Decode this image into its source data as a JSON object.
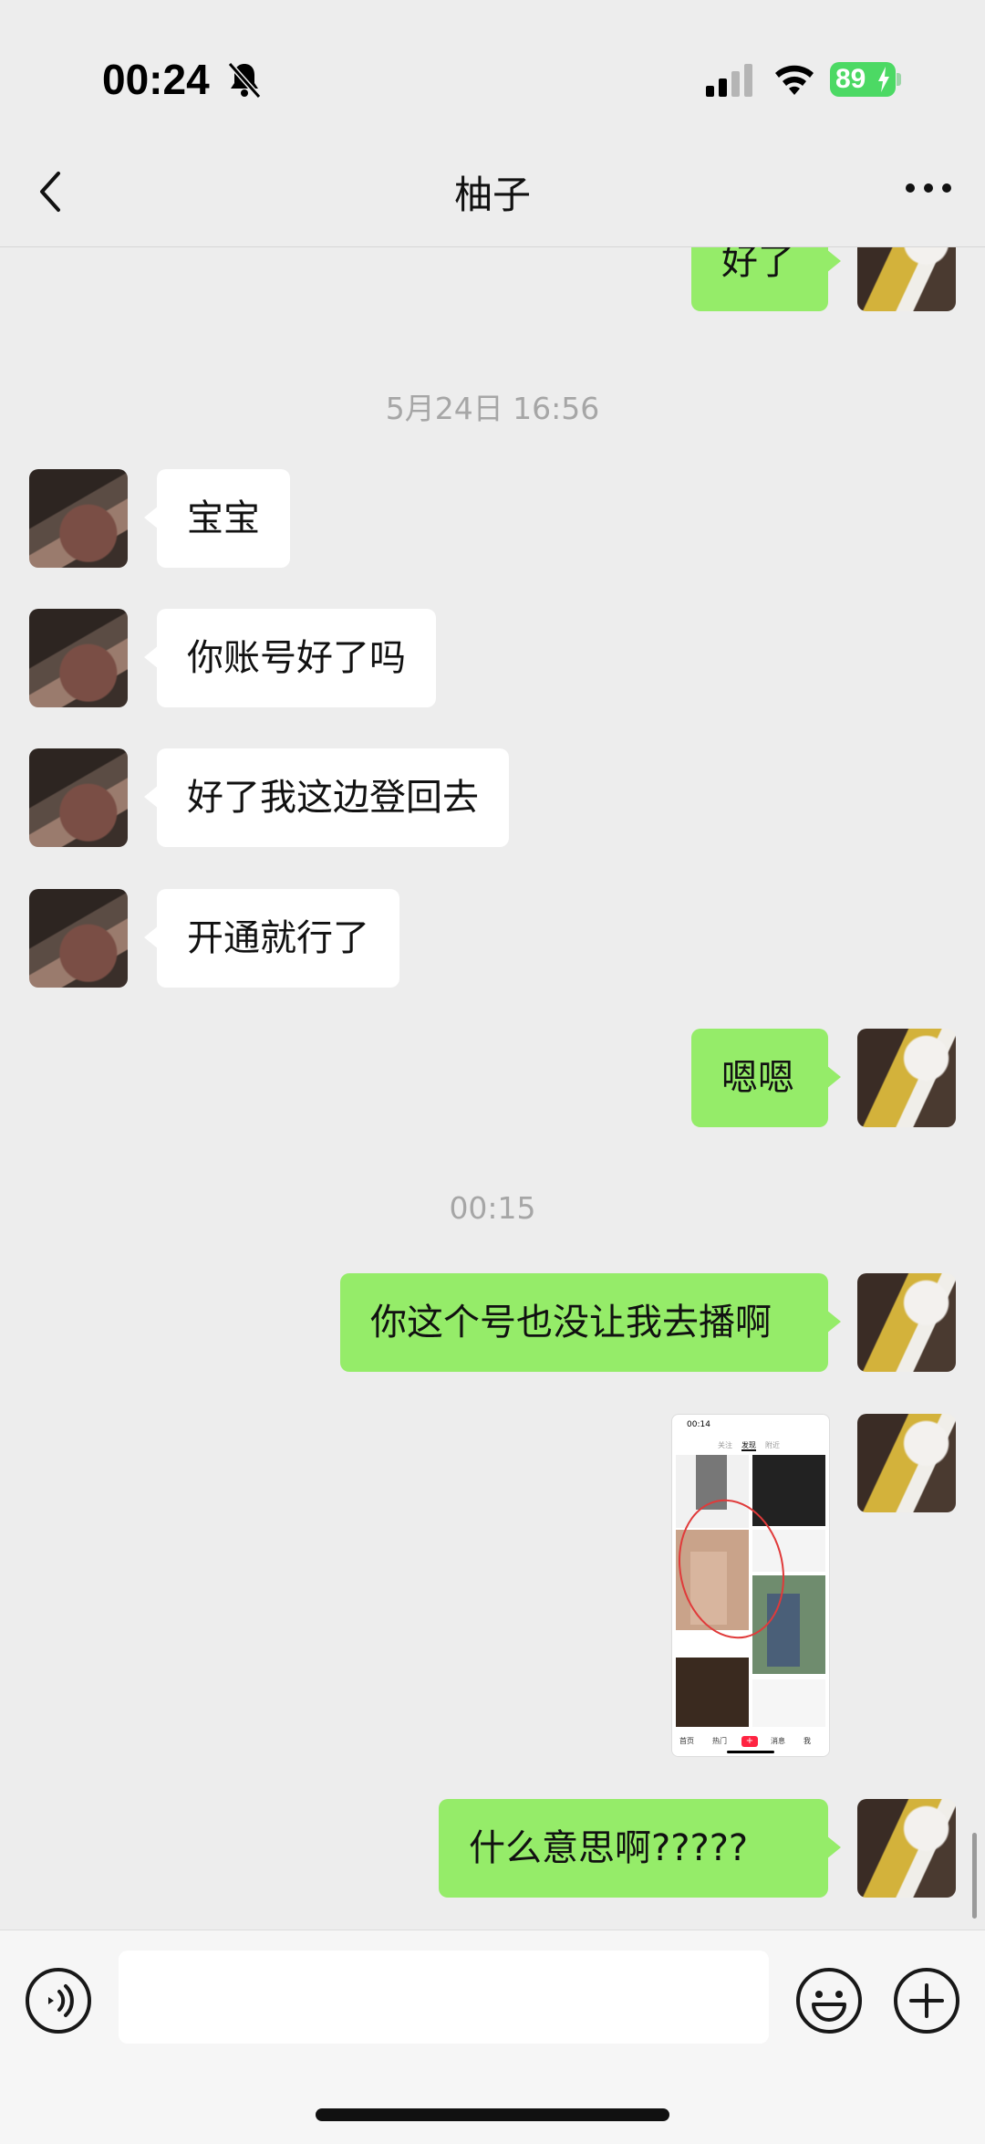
{
  "status_bar": {
    "time": "00:24",
    "battery": "89",
    "icons": [
      "bell-muted-icon",
      "cellular-signal-icon",
      "wifi-icon",
      "battery-charging-icon"
    ]
  },
  "header": {
    "title": "柚子",
    "back_icon": "chevron-left-icon",
    "more_icon": "ellipsis-icon"
  },
  "messages": [
    {
      "from": "me",
      "type": "text",
      "text": "好了"
    },
    {
      "type": "timestamp",
      "text": "5月24日 16:56"
    },
    {
      "from": "other",
      "type": "text",
      "text": "宝宝"
    },
    {
      "from": "other",
      "type": "text",
      "text": "你账号好了吗"
    },
    {
      "from": "other",
      "type": "text",
      "text": "好了我这边登回去"
    },
    {
      "from": "other",
      "type": "text",
      "text": "开通就行了"
    },
    {
      "from": "me",
      "type": "text",
      "text": "嗯嗯"
    },
    {
      "type": "timestamp",
      "text": "00:15"
    },
    {
      "from": "me",
      "type": "text",
      "text": "你这个号也没让我去播啊"
    },
    {
      "from": "me",
      "type": "image",
      "description_time": "00:14"
    },
    {
      "from": "me",
      "type": "text",
      "text": "什么意思啊?????"
    }
  ],
  "image_message": {
    "time": "00:14",
    "tabs": [
      "关注",
      "发现",
      "附近"
    ],
    "nav": [
      "首页",
      "热门",
      "消息",
      "我"
    ]
  },
  "input_bar": {
    "placeholder": "",
    "value": "",
    "icons": [
      "voice-icon",
      "emoji-icon",
      "plus-circle-icon"
    ]
  },
  "colors": {
    "background": "#ededed",
    "my_bubble": "#95ec69",
    "other_bubble": "#ffffff",
    "battery": "#4cd964"
  }
}
